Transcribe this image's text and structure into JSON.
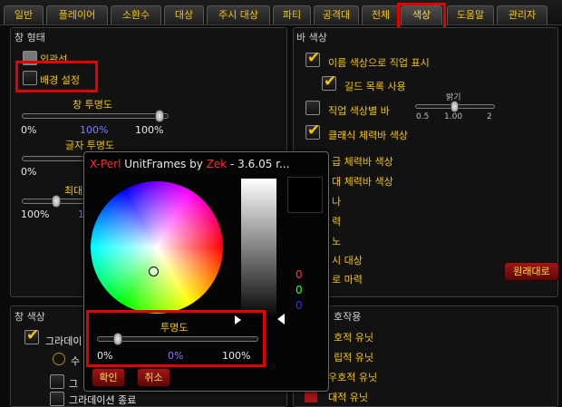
{
  "tabs": [
    {
      "label": "일반"
    },
    {
      "label": "플레이어"
    },
    {
      "label": "소환수"
    },
    {
      "label": "대상"
    },
    {
      "label": "주시 대상"
    },
    {
      "label": "파티"
    },
    {
      "label": "공격대"
    },
    {
      "label": "전체"
    },
    {
      "label": "색상"
    },
    {
      "label": "도움말"
    },
    {
      "label": "관리자"
    }
  ],
  "window_panel": {
    "title": "창 형태",
    "appearance_label": "외관선",
    "background_label": "배경 설정",
    "window_opacity": {
      "label": "창 투명도",
      "min": "0%",
      "value": "100%",
      "max": "100%",
      "fraction": 0.97
    },
    "text_opacity": {
      "label": "글자 투명도",
      "min": "0%"
    },
    "max_label": "최대",
    "max_slider": {
      "min": "100%",
      "value": "1"
    }
  },
  "bar_panel": {
    "title": "바 색상",
    "class_color_name": "이름 색상으로 직업 표시",
    "guild_list": "길드 목록 사용",
    "class_color_bar": "직업 색상별 바",
    "brightness": {
      "label": "밝기",
      "min": "0.5",
      "value": "1.00",
      "max": "2"
    },
    "click_health_bar": "클래식 체력바 색상",
    "partial_rows": [
      "급 체력바 색상",
      "대 체력바 색상",
      "나",
      "력",
      "노",
      "시 대상",
      "로 마력"
    ],
    "reset_button": "원래대로"
  },
  "window_color_panel": {
    "title": "창 색상",
    "gradient_label": "그라데이",
    "row2": "수",
    "row3": "그",
    "gradient_end": "그라데이션 종료"
  },
  "reaction_panel": {
    "title": "호작용",
    "rows": [
      "호적 유닛",
      "립적 유닛",
      "우호적 유닛",
      "대적 유닛"
    ]
  },
  "picker": {
    "title_prefix": "X-Perl",
    "title_main": " UnitFrames by ",
    "title_author": "Zek",
    "title_suffix": " - 3.6.05 r...",
    "rgb": {
      "r": "0",
      "g": "0",
      "b": "0"
    },
    "opacity": {
      "label": "투명도",
      "min": "0%",
      "value": "0%",
      "max": "100%",
      "fraction": 0.1
    },
    "ok_button": "확인",
    "cancel_button": "취소"
  },
  "colors": {
    "accent_gold": "#f1c40f",
    "highlight_red": "#e50000",
    "button_red": "#a11616",
    "author_red": "#ff2a2a"
  }
}
